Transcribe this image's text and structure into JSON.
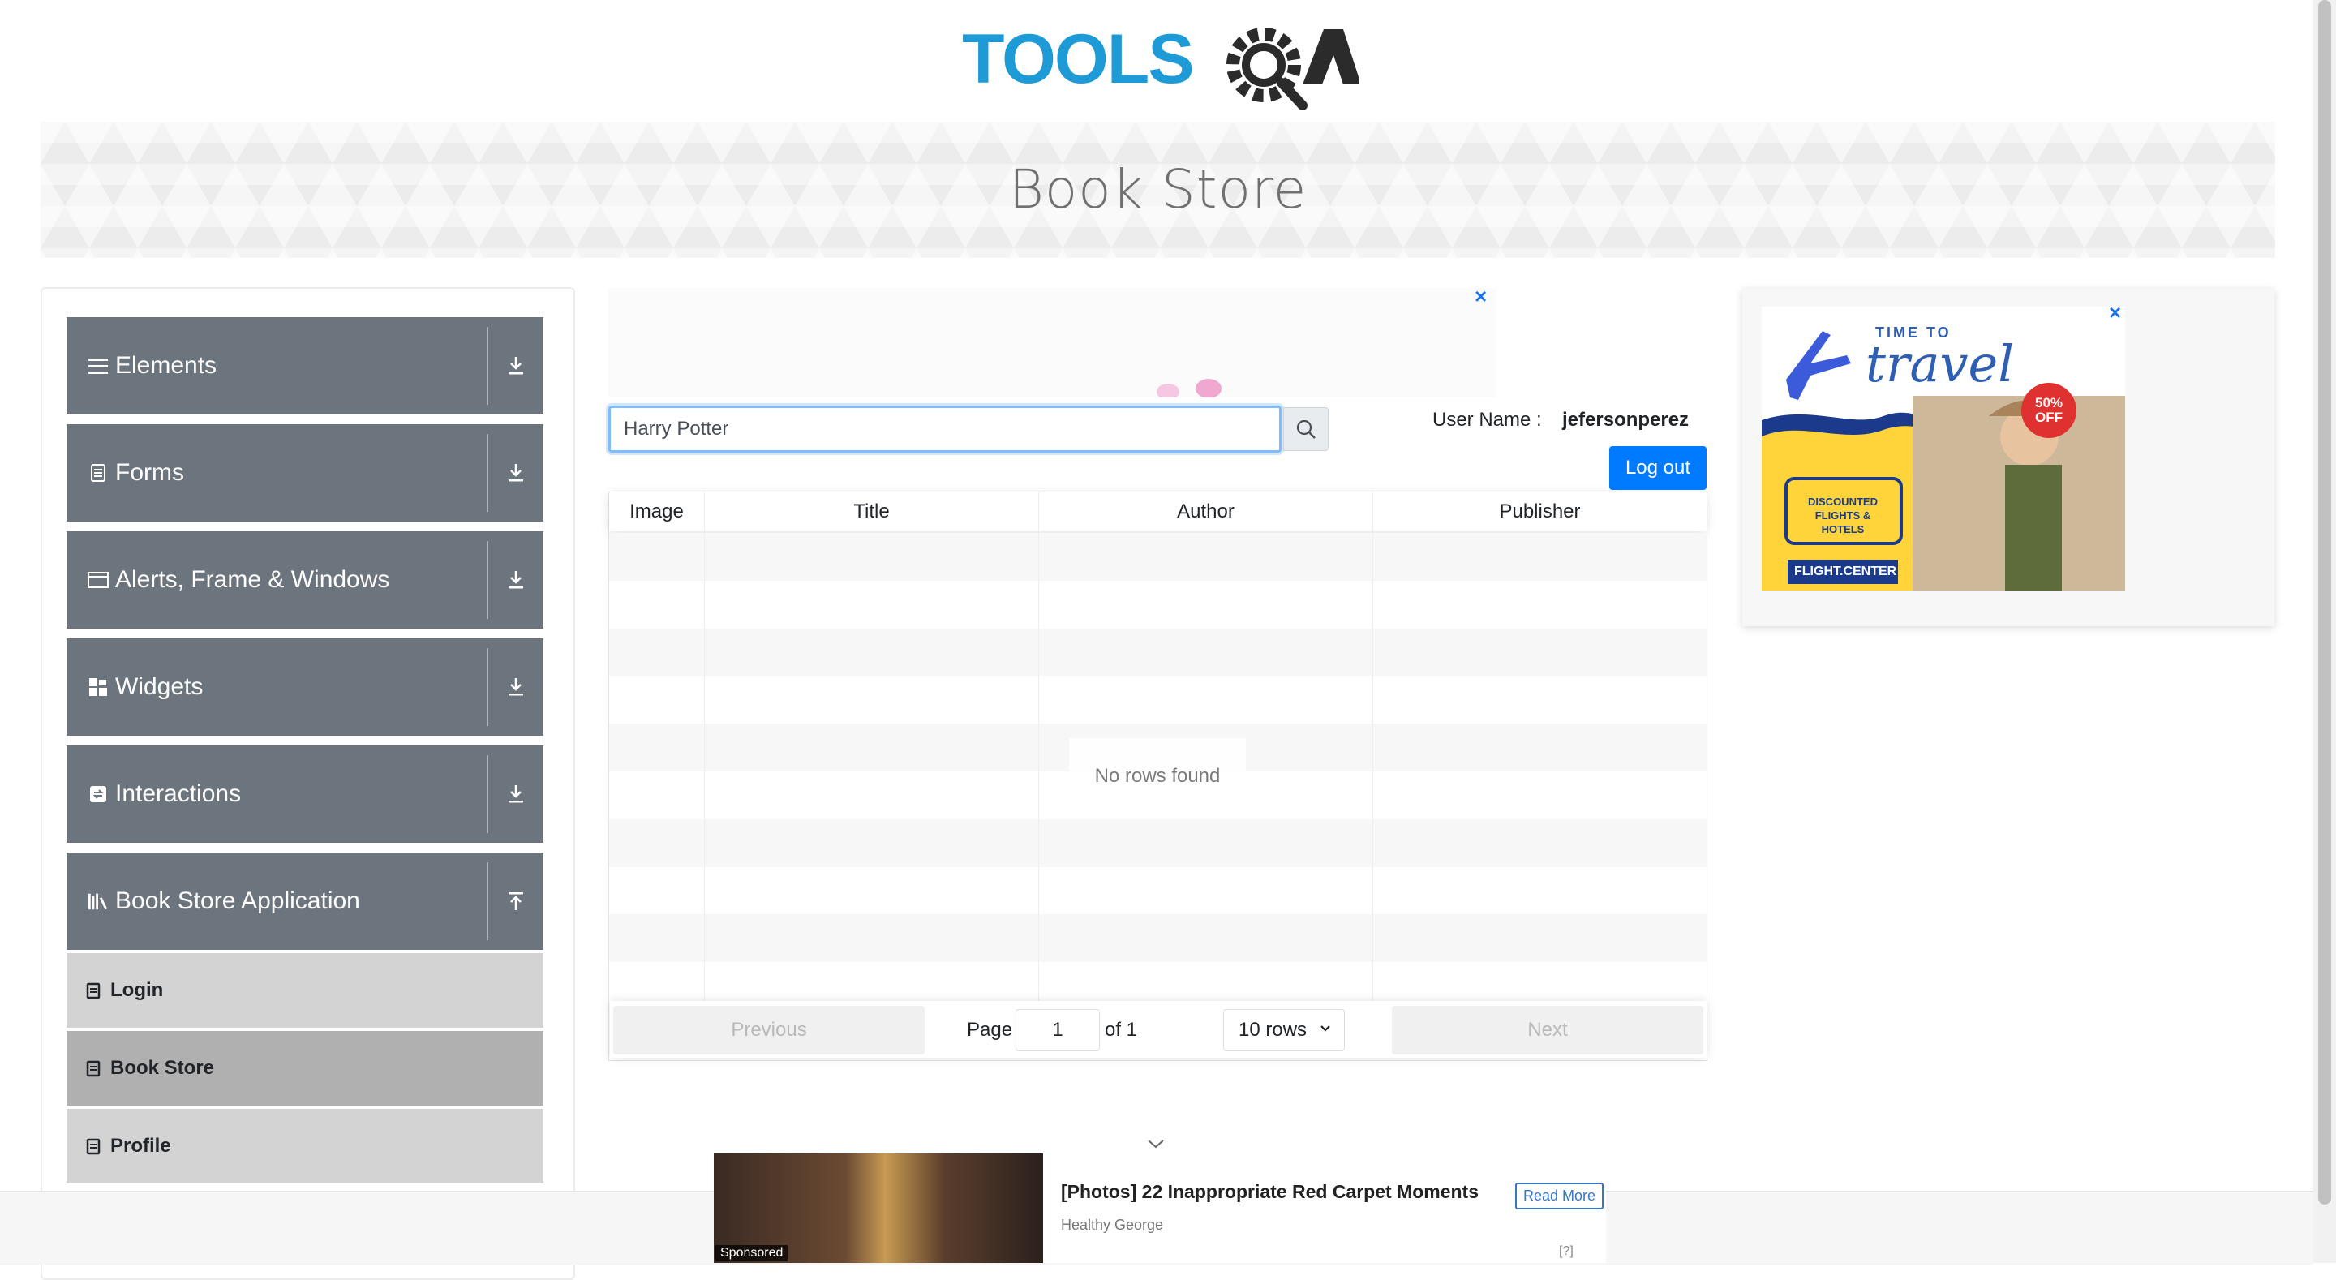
{
  "header": {
    "logo_text": "TOOLSQA",
    "page_title": "Book Store"
  },
  "colors": {
    "menu_header_bg": "#6c757d",
    "menu_item_bg": "#d3d3d3",
    "menu_item_active_bg": "#b0b0b0",
    "primary_button": "#007bff",
    "logo_blue": "#1e9bd7",
    "logo_dark": "#2b2b2b"
  },
  "sidebar": {
    "groups": [
      {
        "label": "Elements",
        "icon": "menu-icon",
        "toggle_icon": "download-arrow-icon"
      },
      {
        "label": "Forms",
        "icon": "document-icon",
        "toggle_icon": "download-arrow-icon"
      },
      {
        "label": "Alerts, Frame & Windows",
        "icon": "window-icon",
        "toggle_icon": "download-arrow-icon"
      },
      {
        "label": "Widgets",
        "icon": "grid-icon",
        "toggle_icon": "download-arrow-icon"
      },
      {
        "label": "Interactions",
        "icon": "interactions-icon",
        "toggle_icon": "download-arrow-icon"
      },
      {
        "label": "Book Store Application",
        "icon": "books-icon",
        "toggle_icon": "upload-arrow-icon",
        "expanded": true
      }
    ],
    "items": [
      {
        "label": "Login",
        "icon": "clipboard-icon",
        "active": false
      },
      {
        "label": "Book Store",
        "icon": "clipboard-icon",
        "active": true
      },
      {
        "label": "Profile",
        "icon": "clipboard-icon",
        "active": false
      }
    ]
  },
  "search": {
    "value": "Harry Potter",
    "button_icon": "search-icon"
  },
  "user": {
    "label": "User Name :",
    "name": "jefersonperez",
    "logout_label": "Log out"
  },
  "table": {
    "columns": [
      "Image",
      "Title",
      "Author",
      "Publisher"
    ],
    "rows": [],
    "empty_message": "No rows found"
  },
  "pagination": {
    "previous_label": "Previous",
    "page_label": "Page",
    "page_value": "1",
    "of_label": "of 1",
    "rows_select": "10 rows",
    "next_label": "Next"
  },
  "ads": {
    "close_icon": "close-icon",
    "right_ad": {
      "line1": "TIME TO",
      "line2": "travel",
      "badge": "50% OFF",
      "tag": "DISCOUNTED FLIGHTS & HOTELS",
      "brand": "FLIGHT.CENTER"
    },
    "bottom_ad": {
      "headline": "[Photos] 22 Inappropriate Red Carpet Moments",
      "source": "Healthy George",
      "button": "Read More",
      "sponsored": "Sponsored",
      "help": "[?]"
    }
  }
}
